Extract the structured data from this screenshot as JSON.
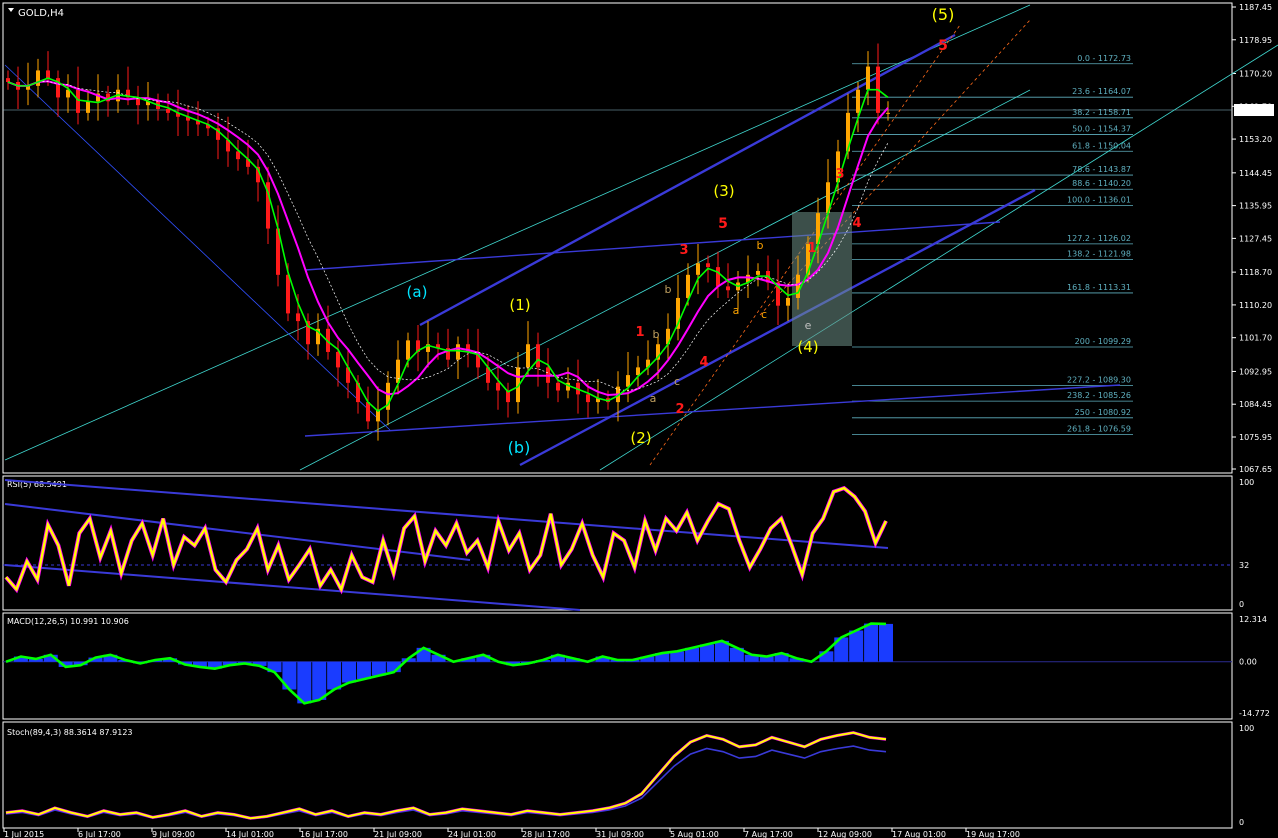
{
  "symbol_label": "GOLD,H4",
  "last_price": "1160.74",
  "colors": {
    "background": "#000000",
    "candle_up": "#ffa500",
    "candle_down": "#ff1a1a",
    "ma_fast": "#00ff00",
    "ma_slow": "#ff00ff",
    "rsi_line": "#ffff00",
    "macd_line": "#00ff00",
    "macd_hist": "#1a3cff",
    "channel": "#3a3ad8",
    "fib": "#5fb0c0"
  },
  "chart_data": [
    {
      "type": "candlestick",
      "title": "GOLD,H4",
      "ylim": [
        1067.65,
        1187.45
      ],
      "price_ticks": [
        "1187.45",
        "1178.95",
        "1170.20",
        "1161.70",
        "1153.20",
        "1144.45",
        "1135.95",
        "1127.45",
        "1118.70",
        "1110.20",
        "1101.70",
        "1092.95",
        "1084.45",
        "1075.95",
        "1067.65"
      ],
      "x_ticks": [
        "1 Jul 2015",
        "6 Jul 17:00",
        "9 Jul 09:00",
        "14 Jul 01:00",
        "16 Jul 17:00",
        "21 Jul 09:00",
        "24 Jul 01:00",
        "28 Jul 17:00",
        "31 Jul 09:00",
        "5 Aug 01:00",
        "7 Aug 17:00",
        "12 Aug 09:00",
        "17 Aug 01:00",
        "19 Aug 17:00"
      ],
      "close_path": [
        1168,
        1166,
        1167,
        1171,
        1169,
        1164,
        1166,
        1160,
        1163,
        1165,
        1163,
        1166,
        1164,
        1162,
        1163,
        1161,
        1160,
        1159,
        1158,
        1157,
        1156,
        1153,
        1150,
        1148,
        1146,
        1142,
        1130,
        1118,
        1108,
        1106,
        1100,
        1104,
        1098,
        1094,
        1090,
        1085,
        1080,
        1083,
        1090,
        1096,
        1101,
        1098,
        1100,
        1099,
        1096,
        1100,
        1098,
        1094,
        1090,
        1088,
        1085,
        1094,
        1100,
        1094,
        1090,
        1088,
        1090,
        1087,
        1085,
        1086,
        1085,
        1089,
        1092,
        1094,
        1096,
        1100,
        1104,
        1112,
        1118,
        1121,
        1120,
        1115,
        1114,
        1116,
        1118,
        1119,
        1116,
        1110,
        1112,
        1118,
        1126,
        1134,
        1142,
        1150,
        1160,
        1166,
        1172,
        1160,
        1160
      ],
      "wave_labels": [
        {
          "text": "(5)",
          "color": "#ffff00"
        },
        {
          "text": "5",
          "color": "#ff1a1a"
        },
        {
          "text": "(3)",
          "color": "#ffff00"
        },
        {
          "text": "5",
          "color": "#ff1a1a"
        },
        {
          "text": "3",
          "color": "#ff1a1a"
        },
        {
          "text": "b",
          "color": "#ffa500"
        },
        {
          "text": "(a)",
          "color": "#00e5ff"
        },
        {
          "text": "(1)",
          "color": "#ffff00"
        },
        {
          "text": "1",
          "color": "#ff1a1a"
        },
        {
          "text": "b",
          "color": "#c0a060"
        },
        {
          "text": "b",
          "color": "#c0a060"
        },
        {
          "text": "a",
          "color": "#ffa500"
        },
        {
          "text": "c",
          "color": "#ffa500"
        },
        {
          "text": "1",
          "color": "#ff1a1a"
        },
        {
          "text": "3",
          "color": "#ff1a1a"
        },
        {
          "text": "4",
          "color": "#ff1a1a"
        },
        {
          "text": "e",
          "color": "#c0c0c0"
        },
        {
          "text": "(4)",
          "color": "#ffff00"
        },
        {
          "text": "4",
          "color": "#ff1a1a"
        },
        {
          "text": "c",
          "color": "#c0a060"
        },
        {
          "text": "a",
          "color": "#c0a060"
        },
        {
          "text": "2",
          "color": "#ff1a1a"
        },
        {
          "text": "(b)",
          "color": "#00e5ff"
        },
        {
          "text": "(2)",
          "color": "#ffff00"
        }
      ],
      "fib_levels": [
        {
          "label": "0.0 - 1172.73",
          "value": 1172.73
        },
        {
          "label": "23.6 - 1164.07",
          "value": 1164.07
        },
        {
          "label": "38.2 - 1158.71",
          "value": 1158.71
        },
        {
          "label": "50.0 - 1154.37",
          "value": 1154.37
        },
        {
          "label": "61.8 - 1150.04",
          "value": 1150.04
        },
        {
          "label": "78.6 - 1143.87",
          "value": 1143.87
        },
        {
          "label": "88.6 - 1140.20",
          "value": 1140.2
        },
        {
          "label": "100.0 - 1136.01",
          "value": 1136.01
        },
        {
          "label": "127.2 - 1126.02",
          "value": 1126.02
        },
        {
          "label": "138.2 - 1121.98",
          "value": 1121.98
        },
        {
          "label": "161.8 - 1113.31",
          "value": 1113.31
        },
        {
          "label": "200 - 1099.29",
          "value": 1099.29
        },
        {
          "label": "227.2 - 1089.30",
          "value": 1089.3
        },
        {
          "label": "238.2 - 1085.26",
          "value": 1085.26
        },
        {
          "label": "250 - 1080.92",
          "value": 1080.92
        },
        {
          "label": "261.8 - 1076.59",
          "value": 1076.59
        }
      ]
    },
    {
      "type": "line",
      "title": "RSI(5) 68.5491",
      "ylim": [
        0,
        100
      ],
      "y_ticks": [
        "100",
        "32",
        "0"
      ],
      "level": 32,
      "values": [
        22,
        12,
        35,
        20,
        65,
        48,
        15,
        58,
        70,
        38,
        60,
        25,
        52,
        66,
        40,
        70,
        32,
        55,
        48,
        62,
        28,
        18,
        36,
        45,
        62,
        28,
        48,
        20,
        32,
        45,
        15,
        28,
        12,
        40,
        22,
        18,
        52,
        25,
        62,
        72,
        35,
        60,
        48,
        66,
        42,
        52,
        30,
        68,
        44,
        58,
        28,
        40,
        74,
        32,
        45,
        66,
        40,
        22,
        58,
        52,
        30,
        68,
        44,
        70,
        60,
        75,
        52,
        68,
        82,
        78,
        52,
        30,
        45,
        62,
        70,
        48,
        24,
        58,
        70,
        92,
        95,
        88,
        76,
        50,
        68
      ]
    },
    {
      "type": "bar+line",
      "title": "MACD(12,26,5) 10.991 10.906",
      "ylim": [
        -14.772,
        12.314
      ],
      "y_ticks": [
        "12.314",
        "0.00",
        "-14.772"
      ],
      "signal": [
        0,
        1.5,
        0.8,
        2,
        -1.5,
        -1,
        1.2,
        2,
        0.5,
        -0.5,
        0.5,
        1,
        -0.8,
        -1.5,
        -2,
        -1,
        -0.5,
        -1.2,
        -3,
        -8,
        -12,
        -11,
        -8,
        -6,
        -5,
        -4,
        -3,
        1,
        4,
        2,
        0,
        1,
        2,
        0,
        -1,
        -0.5,
        0.5,
        2,
        1,
        0,
        1.5,
        0.5,
        0.5,
        1.5,
        2.5,
        3,
        4,
        5,
        6,
        4,
        2,
        1.5,
        2.5,
        1,
        0,
        3,
        7,
        9,
        11,
        10.9
      ]
    },
    {
      "type": "line",
      "title": "Stoch(89,4,3) 88.3614 87.9123",
      "ylim": [
        0,
        100
      ],
      "y_ticks": [
        "100",
        "0"
      ],
      "values": [
        10,
        12,
        8,
        15,
        10,
        6,
        12,
        8,
        10,
        5,
        8,
        12,
        6,
        10,
        8,
        4,
        6,
        10,
        14,
        8,
        12,
        6,
        10,
        8,
        12,
        15,
        8,
        10,
        14,
        12,
        10,
        8,
        12,
        10,
        8,
        10,
        12,
        15,
        20,
        30,
        50,
        70,
        85,
        92,
        88,
        80,
        82,
        90,
        85,
        80,
        88,
        92,
        95,
        90,
        88
      ]
    }
  ]
}
